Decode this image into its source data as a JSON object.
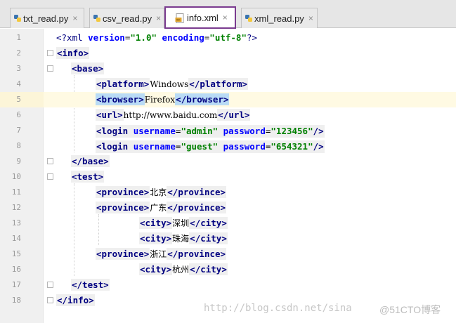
{
  "tabs": [
    {
      "label": "txt_read.py",
      "close": "×",
      "icon": "python-file-icon"
    },
    {
      "label": "csv_read.py",
      "close": "×",
      "icon": "python-file-icon"
    },
    {
      "label": "info.xml",
      "close": "×",
      "icon": "xml-file-icon",
      "active": true
    },
    {
      "label": "xml_read.py",
      "close": "×",
      "icon": "python-file-icon"
    }
  ],
  "colors": {
    "active_tab_border": "#7a3b8f",
    "tag": "#000080",
    "attribute": "#0000ff",
    "attribute_value": "#008000",
    "current_line": "#fffae3",
    "tag_match_highlight": "#b9dbf5"
  },
  "editor": {
    "current_line": 5,
    "lines": [
      {
        "n": "1"
      },
      {
        "n": "2"
      },
      {
        "n": "3"
      },
      {
        "n": "4"
      },
      {
        "n": "5"
      },
      {
        "n": "6"
      },
      {
        "n": "7"
      },
      {
        "n": "8"
      },
      {
        "n": "9"
      },
      {
        "n": "10"
      },
      {
        "n": "11"
      },
      {
        "n": "12"
      },
      {
        "n": "13"
      },
      {
        "n": "14"
      },
      {
        "n": "15"
      },
      {
        "n": "16"
      },
      {
        "n": "17"
      },
      {
        "n": "18"
      }
    ],
    "code": {
      "l1": {
        "open": "<?xml ",
        "a1": "version",
        "eq1": "=",
        "v1": "\"1.0\"",
        "sp": " ",
        "a2": "encoding",
        "eq2": "=",
        "v2": "\"utf-8\"",
        "close": "?>"
      },
      "l2": {
        "tag": "<info>"
      },
      "l3": {
        "tag": "<base>"
      },
      "l4": {
        "open": "<platform>",
        "text": "Windows",
        "close": "</platform>"
      },
      "l5": {
        "open": "<browser>",
        "text": "Firefox",
        "close": "</browser>"
      },
      "l6": {
        "open": "<url>",
        "text": "http://www.baidu.com",
        "close": "</url>"
      },
      "l7": {
        "open": "<login ",
        "a1": "username",
        "eq1": "=",
        "v1": "\"admin\"",
        "sp": " ",
        "a2": "password",
        "eq2": "=",
        "v2": "\"123456\"",
        "close": "/>"
      },
      "l8": {
        "open": "<login ",
        "a1": "username",
        "eq1": "=",
        "v1": "\"guest\"",
        "sp": " ",
        "a2": "password",
        "eq2": "=",
        "v2": "\"654321\"",
        "close": "/>"
      },
      "l9": {
        "tag": "</base>"
      },
      "l10": {
        "tag": "<test>"
      },
      "l11": {
        "open": "<province>",
        "text": "北京",
        "close": "</province>"
      },
      "l12": {
        "open": "<province>",
        "text": "广东",
        "close": "</province>"
      },
      "l13": {
        "open": "<city>",
        "text": "深圳",
        "close": "</city>"
      },
      "l14": {
        "open": "<city>",
        "text": "珠海",
        "close": "</city>"
      },
      "l15": {
        "open": "<province>",
        "text": "浙江",
        "close": "</province>"
      },
      "l16": {
        "open": "<city>",
        "text": "杭州",
        "close": "</city>"
      },
      "l17": {
        "tag": "</test>"
      },
      "l18": {
        "tag": "</info>"
      }
    }
  },
  "watermark": {
    "url": "http://blog.csdn.net/sina",
    "brand": "@51CTO博客"
  }
}
